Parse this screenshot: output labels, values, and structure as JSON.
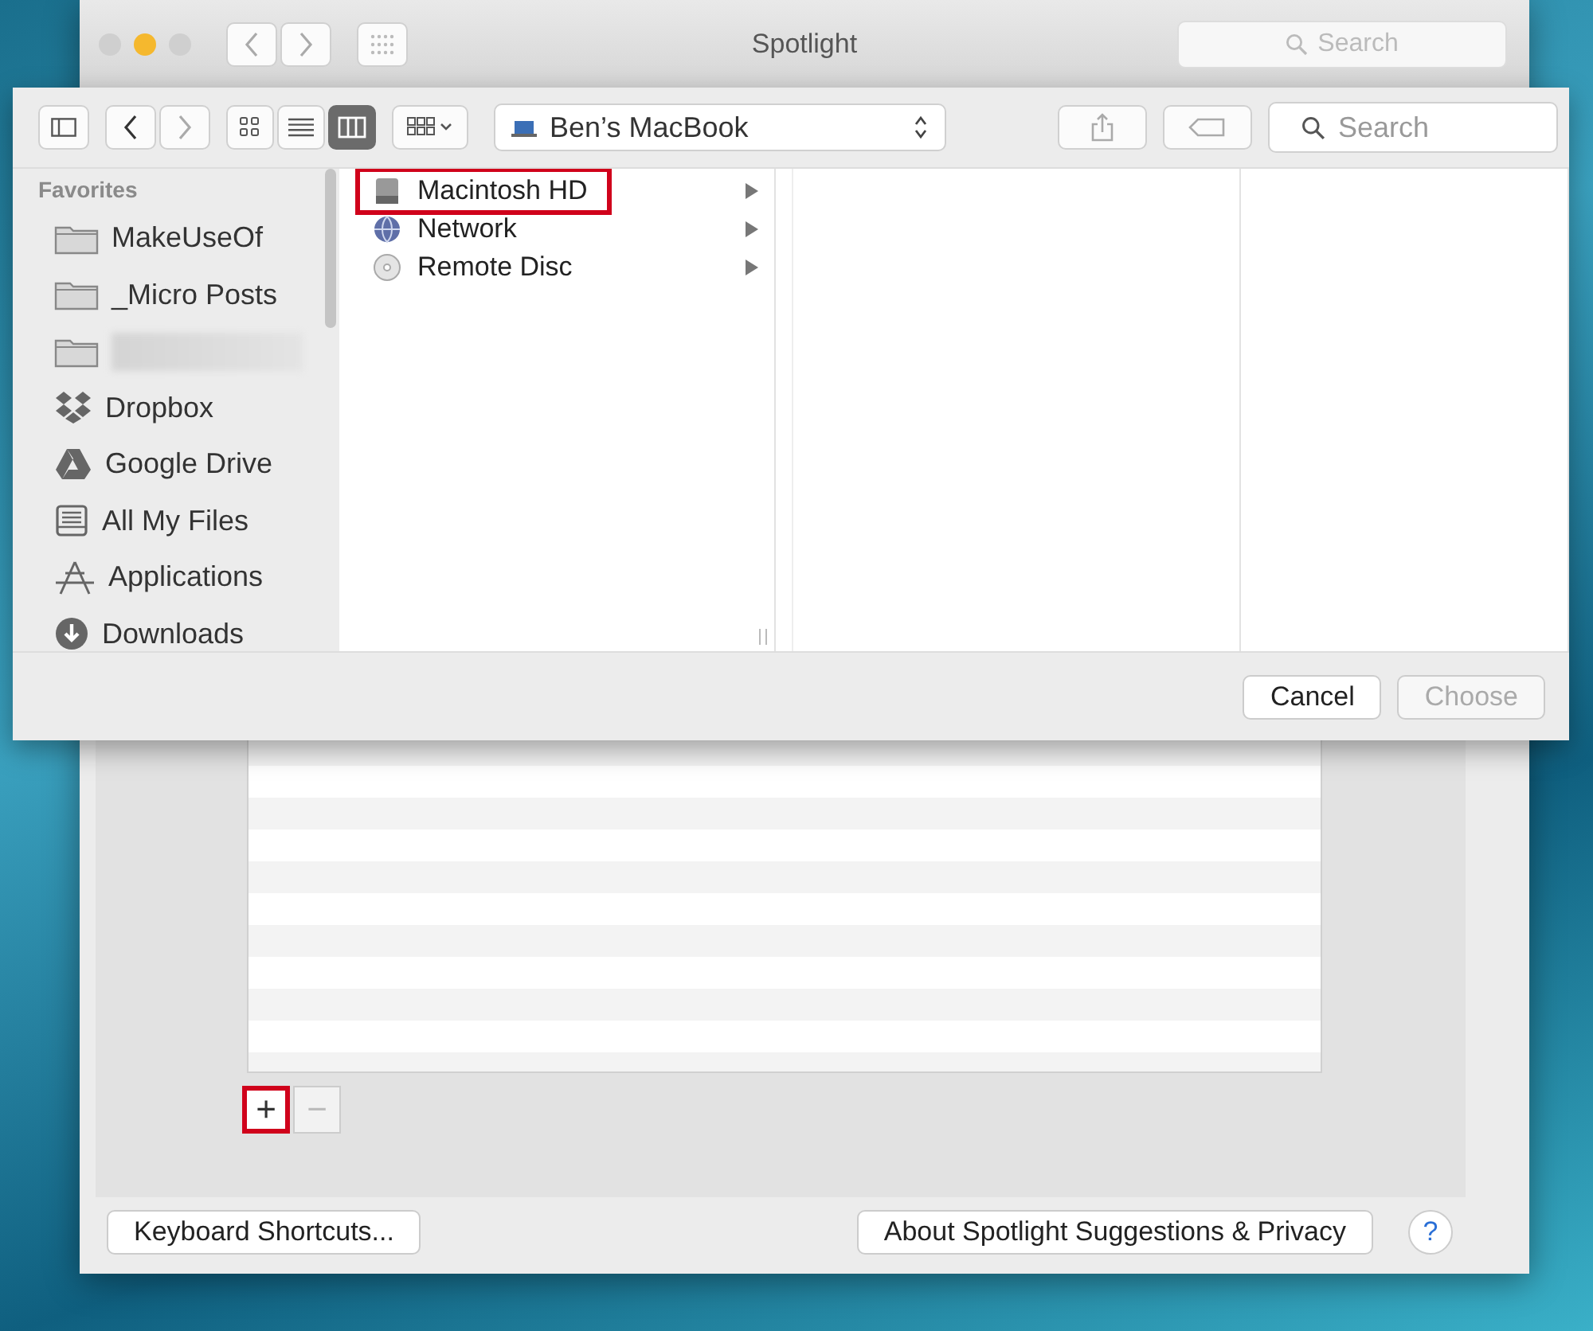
{
  "window": {
    "title": "Spotlight",
    "search": {
      "placeholder": "Search"
    }
  },
  "sheet": {
    "toolbar": {
      "views": [
        {
          "kind": "icons",
          "selected": false
        },
        {
          "kind": "list",
          "selected": false
        },
        {
          "kind": "columns",
          "selected": true
        }
      ],
      "location": "Ben’s MacBook",
      "search": {
        "placeholder": "Search"
      }
    },
    "sidebar": {
      "heading": "Favorites",
      "items": [
        {
          "kind": "folder",
          "label": "MakeUseOf",
          "blurred": false
        },
        {
          "kind": "folder",
          "label": "_Micro Posts",
          "blurred": false
        },
        {
          "kind": "folder",
          "blurred": true
        },
        {
          "kind": "dropbox",
          "label": "Dropbox",
          "blurred": false
        },
        {
          "kind": "drive",
          "label": "Google Drive",
          "blurred": false
        },
        {
          "kind": "files",
          "label": "All My Files",
          "blurred": false
        },
        {
          "kind": "apps",
          "label": "Applications",
          "blurred": false
        },
        {
          "kind": "downloads",
          "label": "Downloads",
          "blurred": false
        }
      ]
    },
    "column_1": [
      {
        "kind": "disk",
        "label": "Macintosh HD",
        "highlighted": true
      },
      {
        "kind": "globe",
        "label": "Network",
        "highlighted": false
      },
      {
        "kind": "disc",
        "label": "Remote Disc",
        "highlighted": false
      }
    ],
    "buttons": [
      {
        "label": "Cancel",
        "disabled": false
      },
      {
        "label": "Choose",
        "disabled": true
      }
    ]
  },
  "list_controls": [
    {
      "kind": "add",
      "label": "+",
      "highlighted": true
    },
    {
      "kind": "remove",
      "label": "−",
      "highlighted": false
    }
  ],
  "footer": {
    "shortcuts": "Keyboard Shortcuts...",
    "about": "About Spotlight Suggestions & Privacy",
    "help": "?"
  }
}
